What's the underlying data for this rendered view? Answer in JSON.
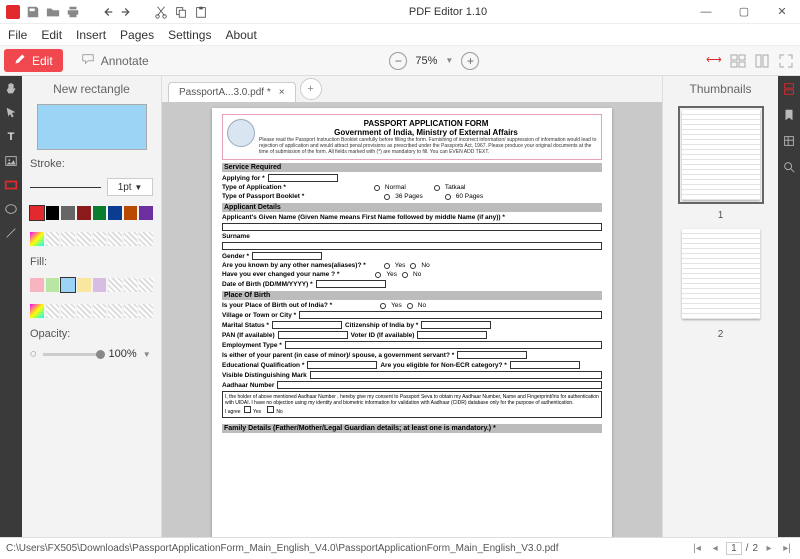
{
  "app": {
    "title": "PDF Editor 1.10"
  },
  "menu": [
    "File",
    "Edit",
    "Insert",
    "Pages",
    "Settings",
    "About"
  ],
  "mode": {
    "edit": "Edit",
    "annotate": "Annotate"
  },
  "zoom": {
    "value": "75%",
    "down": "▼"
  },
  "tab": {
    "name": "PassportA...3.0.pdf *",
    "close": "×",
    "add": "+"
  },
  "inspector": {
    "title": "New rectangle",
    "stroke_lbl": "Stroke:",
    "pt": "1pt",
    "pt_dd": "▼",
    "fill_lbl": "Fill:",
    "opacity_lbl": "Opacity:",
    "opacity_val": "100%",
    "op_dd": "▼"
  },
  "thumbs": {
    "title": "Thumbnails",
    "n1": "1",
    "n2": "2"
  },
  "status": {
    "path": "C:\\Users\\FX505\\Downloads\\PassportApplicationForm_Main_English_V4.0\\PassportApplicationForm_Main_English_V3.0.pdf",
    "cur": "1",
    "sep": "/",
    "total": "2"
  },
  "form": {
    "h1": "PASSPORT APPLICATION FORM",
    "h2": "Government of India, Ministry of External Affairs",
    "instr": "Please read the Passport Instruction Booklet carefully before filling the form. Furnishing of incorrect information/ suppression of information would lead to rejection of application and would attract penal provisions as prescribed under the Passports Act, 1967. Please produce your original documents at the time of submission of the form. All fields marked with (*) are mandatory to fill.   You can EVEN ADD TEXT.",
    "s1": "Service Required",
    "applying": "Applying for *",
    "type_app": "Type of Application *",
    "normal": "Normal",
    "tatkaal": "Tatkaal",
    "type_book": "Type of Passport Booklet *",
    "p36": "36 Pages",
    "p60": "60 Pages",
    "s2": "Applicant Details",
    "given": "Applicant's Given Name (Given Name means First Name followed by middle Name (if any)) *",
    "surname": "Surname",
    "gender": "Gender *",
    "aliases": "Are you known by any other names(aliases)? *",
    "yes": "Yes",
    "no": "No",
    "changed": "Have you ever changed your name ? *",
    "dob": "Date of Birth (DD/MM/YYYY) *",
    "s3": "Place Of Birth",
    "pob_out": "Is your Place of Birth out of India? *",
    "village": "Village or Town or City *",
    "marital": "Marital Status *",
    "citizen": "Citizenship of India by *",
    "pan": "PAN (If available)",
    "voter": "Voter ID (If available)",
    "employ": "Employment Type *",
    "parent": "Is either of your parent (in case of minor)/ spouse, a government servant? *",
    "edu": "Educational Qualification *",
    "ecr": "Are you eligible for Non-ECR category? *",
    "mark": "Visible Distinguishing Mark",
    "aadhaar": "Aadhaar Number",
    "consent": "I, the holder of above mentioned Aadhaar Number , hereby give my consent to Passport Seva to obtain my Aadhaar Number, Name and Fingerprint/Iris for authentication with UIDAI. I have no objection using my identity and biometric information for validation with Aadhaar (CIDR) database only for the purpose of authentication.",
    "agree": "I agree",
    "s4": "Family Details (Father/Mother/Legal Guardian details; at least one is mandatory.) *"
  }
}
